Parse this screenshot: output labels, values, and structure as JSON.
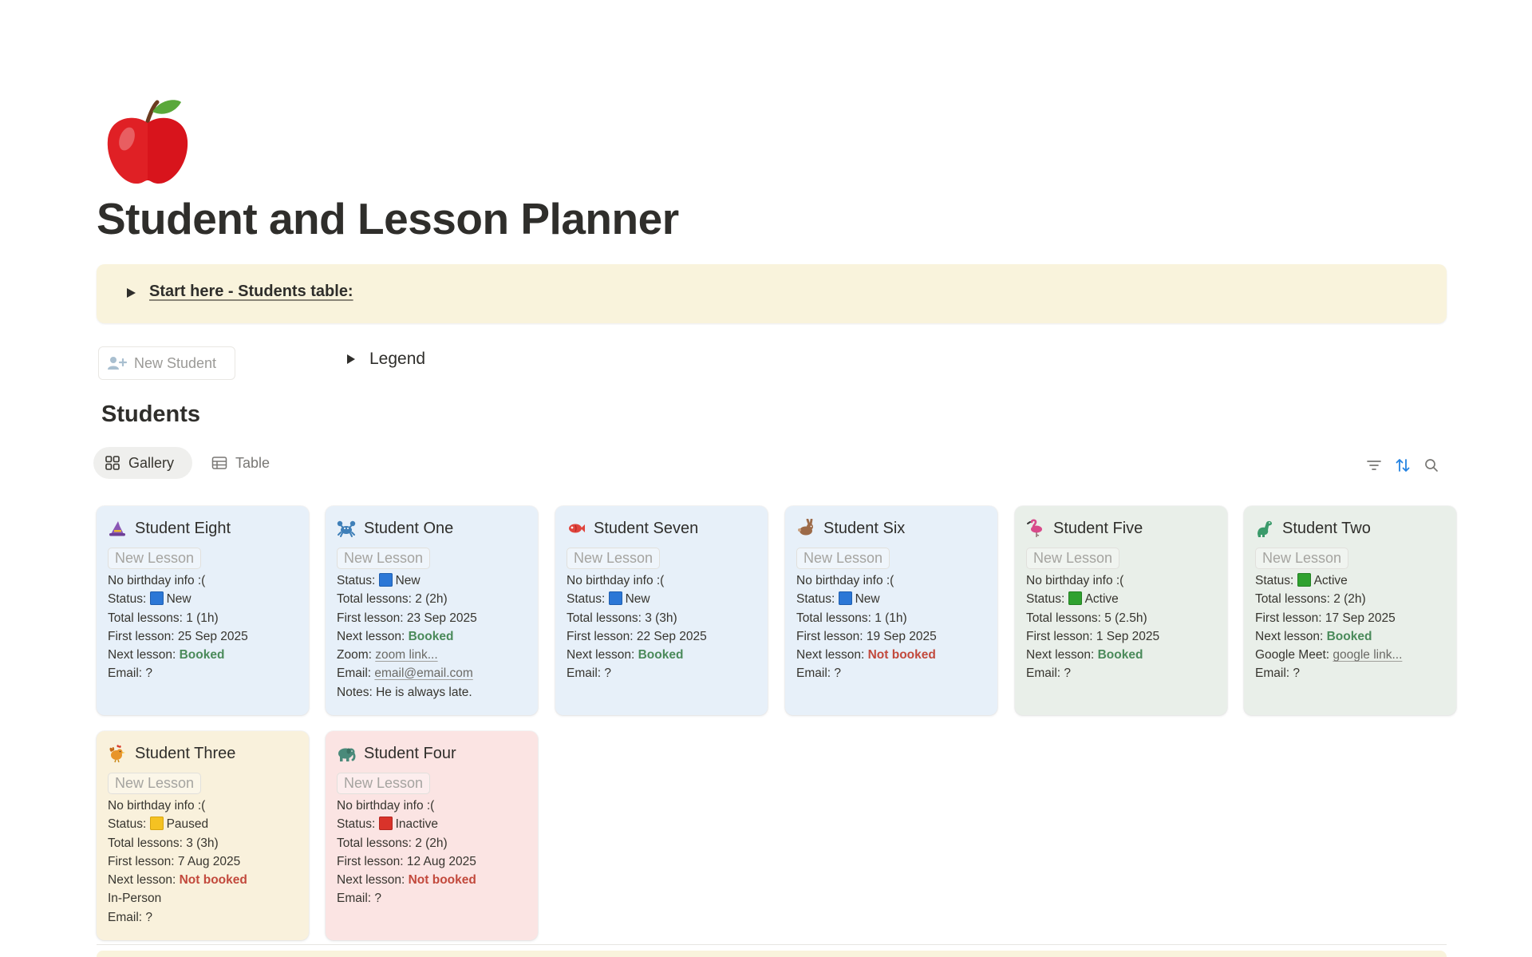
{
  "page": {
    "title": "Student and Lesson Planner",
    "icon": "red-apple-icon"
  },
  "callout": {
    "label": "Start here - Students table:"
  },
  "new_student_button": {
    "label": "New Student",
    "icon": "add-person-icon"
  },
  "legend": {
    "label": "Legend"
  },
  "section": {
    "title": "Students"
  },
  "views": {
    "gallery": "Gallery",
    "table": "Table",
    "active": "Gallery"
  },
  "toolbar": {
    "icons": [
      "filter-icon",
      "sort-icon",
      "search-icon"
    ],
    "sort_color": "#2383e2"
  },
  "colors": {
    "status_new": "#2b77d6",
    "status_active": "#2fa12f",
    "status_paused": "#f5c222",
    "status_inactive": "#d9332a",
    "booked": "#4a8a5a",
    "not_booked": "#c2493c",
    "card_blue": "#e7f0f9",
    "card_green": "#e9efe9",
    "card_yellow": "#f9f1dc",
    "card_red": "#fbe4e3"
  },
  "new_lesson_label": "New Lesson",
  "cards": [
    {
      "name": "Student Eight",
      "icon": "witch-hat-icon",
      "theme": "blue",
      "lines": [
        {
          "text": "No birthday info :("
        },
        {
          "label": "Status: ",
          "status": "new",
          "value": "New"
        },
        {
          "text": "Total lessons: 1 (1h)"
        },
        {
          "text": "First lesson: 25 Sep 2025"
        },
        {
          "label": "Next lesson: ",
          "booking": "ok",
          "value": "Booked"
        },
        {
          "text": "Email: ?"
        }
      ]
    },
    {
      "name": "Student One",
      "icon": "crab-icon",
      "theme": "blue",
      "lines": [
        {
          "label": "Status: ",
          "status": "new",
          "value": "New"
        },
        {
          "text": "Total lessons: 2 (2h)"
        },
        {
          "text": "First lesson: 23 Sep 2025"
        },
        {
          "label": "Next lesson: ",
          "booking": "ok",
          "value": "Booked"
        },
        {
          "label": "Zoom: ",
          "link": "zoom link..."
        },
        {
          "label": "Email: ",
          "link": "email@email.com"
        },
        {
          "text": "Notes: He is always late."
        }
      ]
    },
    {
      "name": "Student Seven",
      "icon": "fish-icon",
      "theme": "blue",
      "lines": [
        {
          "text": "No birthday info :("
        },
        {
          "label": "Status: ",
          "status": "new",
          "value": "New"
        },
        {
          "text": "Total lessons: 3 (3h)"
        },
        {
          "text": "First lesson: 22 Sep 2025"
        },
        {
          "label": "Next lesson: ",
          "booking": "ok",
          "value": "Booked"
        },
        {
          "text": "Email: ?"
        }
      ]
    },
    {
      "name": "Student Six",
      "icon": "rabbit-icon",
      "theme": "blue",
      "lines": [
        {
          "text": "No birthday info :("
        },
        {
          "label": "Status: ",
          "status": "new",
          "value": "New"
        },
        {
          "text": "Total lessons: 1 (1h)"
        },
        {
          "text": "First lesson: 19 Sep 2025"
        },
        {
          "label": "Next lesson: ",
          "booking": "bad",
          "value": "Not booked"
        },
        {
          "text": "Email: ?"
        }
      ]
    },
    {
      "name": "Student Five",
      "icon": "flamingo-icon",
      "theme": "green",
      "lines": [
        {
          "text": "No birthday info :("
        },
        {
          "label": "Status: ",
          "status": "active",
          "value": "Active"
        },
        {
          "text": "Total lessons: 5 (2.5h)"
        },
        {
          "text": "First lesson: 1 Sep 2025"
        },
        {
          "label": "Next lesson: ",
          "booking": "ok",
          "value": "Booked"
        },
        {
          "text": "Email: ?"
        }
      ]
    },
    {
      "name": "Student Two",
      "icon": "dinosaur-icon",
      "theme": "green",
      "lines": [
        {
          "label": "Status: ",
          "status": "active",
          "value": "Active"
        },
        {
          "text": "Total lessons: 2 (2h)"
        },
        {
          "text": "First lesson: 17 Sep 2025"
        },
        {
          "label": "Next lesson: ",
          "booking": "ok",
          "value": "Booked"
        },
        {
          "label": "Google Meet: ",
          "link": "google link..."
        },
        {
          "text": "Email: ?"
        }
      ]
    },
    {
      "name": "Student Three",
      "icon": "rooster-icon",
      "theme": "yellow",
      "lines": [
        {
          "text": "No birthday info :("
        },
        {
          "label": "Status: ",
          "status": "paused",
          "value": "Paused"
        },
        {
          "text": "Total lessons: 3 (3h)"
        },
        {
          "text": "First lesson: 7 Aug 2025"
        },
        {
          "label": "Next lesson: ",
          "booking": "bad",
          "value": "Not booked"
        },
        {
          "text": "In-Person"
        },
        {
          "text": "Email: ?"
        }
      ]
    },
    {
      "name": "Student Four",
      "icon": "elephant-icon",
      "theme": "red",
      "lines": [
        {
          "text": "No birthday info :("
        },
        {
          "label": "Status: ",
          "status": "inactive",
          "value": "Inactive"
        },
        {
          "text": "Total lessons: 2 (2h)"
        },
        {
          "text": "First lesson: 12 Aug 2025"
        },
        {
          "label": "Next lesson: ",
          "booking": "bad",
          "value": "Not booked"
        },
        {
          "text": "Email: ?"
        }
      ]
    }
  ]
}
